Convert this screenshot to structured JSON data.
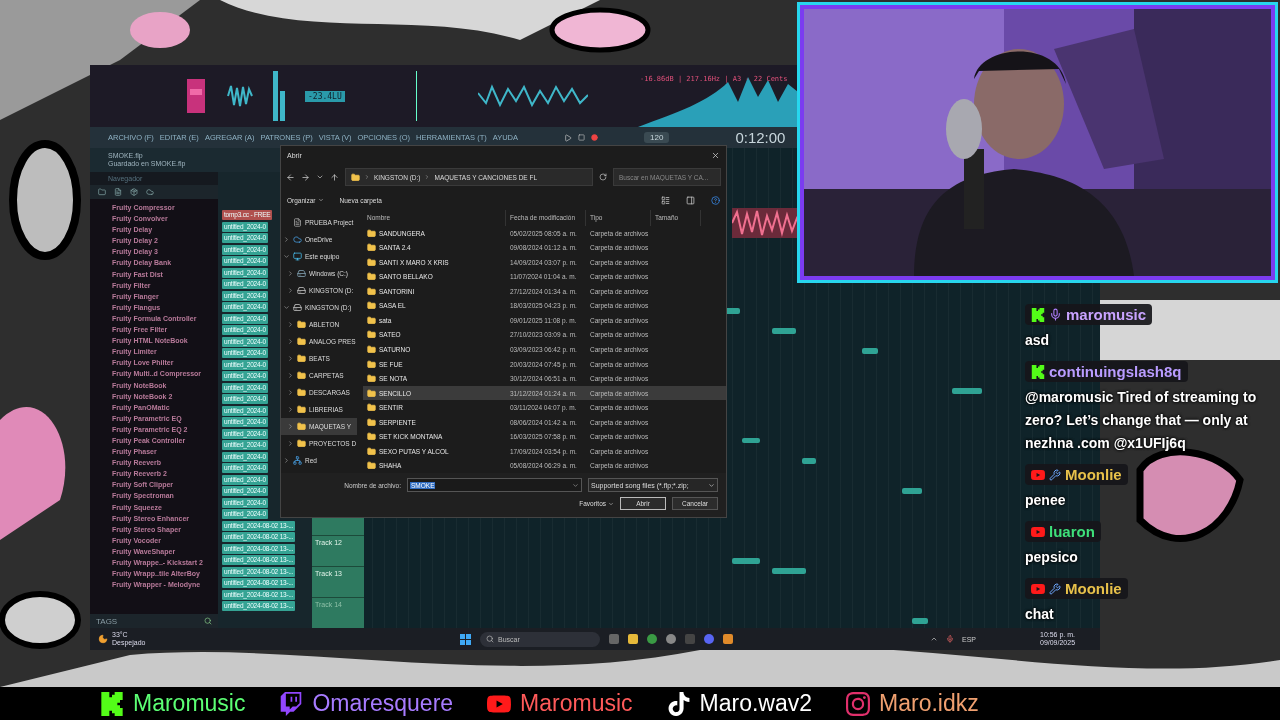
{
  "visualizer": {
    "loudness": "-23.4LU",
    "pitch_reading": "-16.86dB | 217.16Hz | A3 - 22 Cents"
  },
  "menu_bar": {
    "items": [
      "ARCHIVO (F)",
      "EDITAR (E)",
      "AGREGAR (A)",
      "PATRONES (P)",
      "VISTA (V)",
      "OPCIONES (O)",
      "HERRAMIENTAS (T)",
      "AYUDA"
    ],
    "tempo": "120",
    "time": "0:12:00"
  },
  "hint_bar": {
    "title": "SMOKE.flp",
    "subtitle": "Guardado en SMOKE.flp"
  },
  "browser": {
    "title": "Navegador",
    "footer": "TAGS",
    "plugins": [
      "Fruity Compressor",
      "Fruity Convolver",
      "Fruity Delay",
      "Fruity Delay 2",
      "Fruity Delay 3",
      "Fruity Delay Bank",
      "Fruity Fast Dist",
      "Fruity Filter",
      "Fruity Flanger",
      "Fruity Flangus",
      "Fruity Formula Controller",
      "Fruity Free Filter",
      "Fruity HTML NoteBook",
      "Fruity Limiter",
      "Fruity Love Philter",
      "Fruity Multi..d Compressor",
      "Fruity NoteBook",
      "Fruity NoteBook 2",
      "Fruity PanOMatic",
      "Fruity Parametric EQ",
      "Fruity Parametric EQ 2",
      "Fruity Peak Controller",
      "Fruity Phaser",
      "Fruity Reeverb",
      "Fruity Reeverb 2",
      "Fruity Soft Clipper",
      "Fruity Spectroman",
      "Fruity Squeeze",
      "Fruity Stereo Enhancer",
      "Fruity Stereo Shaper",
      "Fruity Vocoder",
      "Fruity WaveShaper",
      "Fruity Wrappe..- Kickstart 2",
      "Fruity Wrapp..tile AlterBoy",
      "Fruity Wrapper - Melodyne"
    ]
  },
  "patterns": [
    {
      "name": "tomp3.cc - FREE",
      "color": "#b0504e"
    },
    {
      "name": "untitled_2024-0",
      "color": "#35a394"
    },
    {
      "name": "untitled_2024-0",
      "color": "#35a394"
    },
    {
      "name": "untitled_2024-0",
      "color": "#35a394"
    },
    {
      "name": "untitled_2024-0",
      "color": "#35a394"
    },
    {
      "name": "untitled_2024-0",
      "color": "#35a394"
    },
    {
      "name": "untitled_2024-0",
      "color": "#35a394"
    },
    {
      "name": "untitled_2024-0",
      "color": "#35a394"
    },
    {
      "name": "untitled_2024-0",
      "color": "#35a394"
    },
    {
      "name": "untitled_2024-0",
      "color": "#35a394"
    },
    {
      "name": "untitled_2024-0",
      "color": "#35a394"
    },
    {
      "name": "untitled_2024-0",
      "color": "#35a394"
    },
    {
      "name": "untitled_2024-0",
      "color": "#35a394"
    },
    {
      "name": "untitled_2024-0",
      "color": "#35a394"
    },
    {
      "name": "untitled_2024-0",
      "color": "#35a394"
    },
    {
      "name": "untitled_2024-0",
      "color": "#35a394"
    },
    {
      "name": "untitled_2024-0",
      "color": "#35a394"
    },
    {
      "name": "untitled_2024-0",
      "color": "#35a394"
    },
    {
      "name": "untitled_2024-0",
      "color": "#35a394"
    },
    {
      "name": "untitled_2024-0",
      "color": "#35a394"
    },
    {
      "name": "untitled_2024-0",
      "color": "#35a394"
    },
    {
      "name": "untitled_2024-0",
      "color": "#35a394"
    },
    {
      "name": "untitled_2024-0",
      "color": "#35a394"
    },
    {
      "name": "untitled_2024-0",
      "color": "#35a394"
    },
    {
      "name": "untitled_2024-0",
      "color": "#35a394"
    },
    {
      "name": "untitled_2024-0",
      "color": "#35a394"
    },
    {
      "name": "untitled_2024-0",
      "color": "#35a394"
    },
    {
      "name": "untitled_2024-08-02 13-...",
      "color": "#35a394"
    },
    {
      "name": "untitled_2024-08-02 13-...",
      "color": "#35a394"
    },
    {
      "name": "untitled_2024-08-02 13-...",
      "color": "#35a394"
    },
    {
      "name": "untitled_2024-08-02 13-...",
      "color": "#35a394"
    },
    {
      "name": "untitled_2024-08-02 13-...",
      "color": "#35a394"
    },
    {
      "name": "untitled_2024-08-02 13-...",
      "color": "#35a394"
    },
    {
      "name": "untitled_2024-08-02 13-...",
      "color": "#35a394"
    },
    {
      "name": "untitled_2024-08-02 13-...",
      "color": "#35a394"
    }
  ],
  "playlist": {
    "tracks": [
      "Track 12",
      "Track 13",
      "Track 14"
    ]
  },
  "dialog": {
    "title": "Abrir",
    "path": [
      "KINGSTON (D:)",
      "MAQUETAS Y CANCIONES DE FL"
    ],
    "search_placeholder": "Buscar en MAQUETAS Y CA...",
    "commands": [
      "Organizar",
      "Nueva carpeta"
    ],
    "nav": [
      {
        "label": "PRUEBA Project",
        "kind": "project",
        "selected": false
      },
      {
        "label": "OneDrive",
        "kind": "cloud",
        "expanded": false,
        "selected": false
      },
      {
        "label": "Este equipo",
        "kind": "computer",
        "expanded": true,
        "selected": false,
        "children": [
          {
            "label": "Windows (C:)",
            "kind": "disk",
            "expanded": false,
            "selected": false
          },
          {
            "label": "KINGSTON (D:",
            "kind": "drive",
            "expanded": false,
            "selected": false
          }
        ]
      },
      {
        "label": "KINGSTON (D:)",
        "kind": "drive",
        "expanded": true,
        "selected": false,
        "children": [
          {
            "label": "ABLETON",
            "kind": "folder",
            "expanded": false,
            "selected": false
          },
          {
            "label": "ANALOG PRES",
            "kind": "folder",
            "expanded": false,
            "selected": false
          },
          {
            "label": "BEATS",
            "kind": "folder",
            "expanded": false,
            "selected": false
          },
          {
            "label": "CARPETAS",
            "kind": "folder",
            "expanded": false,
            "selected": false
          },
          {
            "label": "DESCARGAS",
            "kind": "folder",
            "expanded": false,
            "selected": false
          },
          {
            "label": "LIBRERIAS",
            "kind": "folder",
            "expanded": false,
            "selected": false
          },
          {
            "label": "MAQUETAS Y",
            "kind": "folder",
            "expanded": false,
            "selected": true
          },
          {
            "label": "PROYECTOS D",
            "kind": "folder",
            "expanded": false,
            "selected": false
          }
        ]
      },
      {
        "label": "Red",
        "kind": "network",
        "expanded": false,
        "selected": false
      }
    ],
    "columns": [
      "Nombre",
      "Fecha de modificación",
      "Tipo",
      "Tamaño"
    ],
    "files": [
      {
        "name": "SANDUNGERA",
        "date": "05/02/2025 08:05 a. m.",
        "type": "Carpeta de archivos",
        "selected": false
      },
      {
        "name": "SANTA 2.4",
        "date": "09/08/2024 01:12 a. m.",
        "type": "Carpeta de archivos",
        "selected": false
      },
      {
        "name": "SANTI X MARO X KRIS",
        "date": "14/09/2024 03:07 p. m.",
        "type": "Carpeta de archivos",
        "selected": false
      },
      {
        "name": "SANTO BELLAKO",
        "date": "11/07/2024 01:04 a. m.",
        "type": "Carpeta de archivos",
        "selected": false
      },
      {
        "name": "SANTORINI",
        "date": "27/12/2024 01:34 a. m.",
        "type": "Carpeta de archivos",
        "selected": false
      },
      {
        "name": "SASA EL",
        "date": "18/03/2025 04:23 p. m.",
        "type": "Carpeta de archivos",
        "selected": false
      },
      {
        "name": "sata",
        "date": "09/01/2025 11:08 p. m.",
        "type": "Carpeta de archivos",
        "selected": false
      },
      {
        "name": "SATEO",
        "date": "27/10/2023 03:09 a. m.",
        "type": "Carpeta de archivos",
        "selected": false
      },
      {
        "name": "SATURNO",
        "date": "03/09/2023 06:42 p. m.",
        "type": "Carpeta de archivos",
        "selected": false
      },
      {
        "name": "SE FUE",
        "date": "20/03/2024 07:45 p. m.",
        "type": "Carpeta de archivos",
        "selected": false
      },
      {
        "name": "SE NOTA",
        "date": "30/12/2024 06:51 a. m.",
        "type": "Carpeta de archivos",
        "selected": false
      },
      {
        "name": "SENCILLO",
        "date": "31/12/2024 01:24 a. m.",
        "type": "Carpeta de archivos",
        "selected": true
      },
      {
        "name": "SENTIR",
        "date": "03/11/2024 04:07 p. m.",
        "type": "Carpeta de archivos",
        "selected": false
      },
      {
        "name": "SERPIENTE",
        "date": "08/06/2024 01:42 a. m.",
        "type": "Carpeta de archivos",
        "selected": false
      },
      {
        "name": "SET KICK MONTANA",
        "date": "16/03/2025 07:58 p. m.",
        "type": "Carpeta de archivos",
        "selected": false
      },
      {
        "name": "SEXO PUTAS Y ALCOL",
        "date": "17/09/2024 03:54 p. m.",
        "type": "Carpeta de archivos",
        "selected": false
      },
      {
        "name": "SHAHA",
        "date": "05/08/2024 06:29 a. m.",
        "type": "Carpeta de archivos",
        "selected": false
      }
    ],
    "filename_label": "Nombre de archivo:",
    "filename": "SMOKE",
    "filter": "Supported song files (*.flp;*.zip;",
    "favorites": "Favoritos",
    "open_button": "Abrir",
    "cancel_button": "Cancelar"
  },
  "taskbar": {
    "temperature": "33°C",
    "weather": "Despejado",
    "search_placeholder": "Buscar",
    "language": "ESP",
    "time": "10:56 p. m.",
    "date": "09/09/2025"
  },
  "chat": [
    {
      "kind": "kick",
      "badges": [
        {
          "kind": "mic"
        }
      ],
      "user": "maromusic",
      "color": "#c9a3ff",
      "message": "asd"
    },
    {
      "kind": "kick",
      "user": "continuingslash8q",
      "color": "#b99cff",
      "message": "@maromusic Tired of streaming to zero? Let’s change that — only at nezhna .com @x1UFIj6q"
    },
    {
      "kind": "youtube",
      "badges": [
        {
          "kind": "wrench"
        }
      ],
      "user": "Moonlie",
      "color": "#e8c14a",
      "message": "penee"
    },
    {
      "kind": "youtube",
      "user": "luaron",
      "color": "#3ee07a",
      "message": "pepsico"
    },
    {
      "kind": "youtube",
      "badges": [
        {
          "kind": "wrench"
        }
      ],
      "user": "Moonlie",
      "color": "#e8c14a",
      "message": "chat"
    }
  ],
  "socials": [
    {
      "kind": "kick",
      "handle": "Maromusic",
      "color": "#5cff74"
    },
    {
      "kind": "twitch",
      "handle": "Omaresquere",
      "color": "#a77bff"
    },
    {
      "kind": "youtube",
      "handle": "Maromusic",
      "color": "#ff5a5a"
    },
    {
      "kind": "tiktok",
      "handle": "Maro.wav2",
      "color": "#ffffff"
    },
    {
      "kind": "instagram",
      "handle": "Maro.idkz",
      "color": "#f0a070"
    }
  ]
}
